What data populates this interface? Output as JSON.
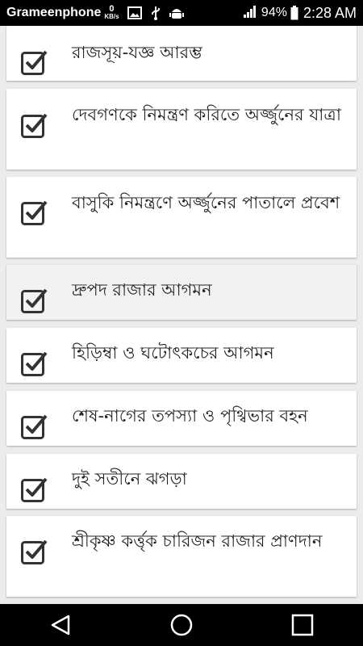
{
  "status_bar": {
    "carrier": "Grameenphone",
    "speed_value": "0",
    "speed_unit": "KB/s",
    "icons": [
      "image-icon",
      "usb-icon",
      "android-debug-icon"
    ],
    "signal": "signal-icon",
    "battery_percent": "94%",
    "time": "2:28 AM"
  },
  "chapters": [
    {
      "label": "রাজসূয়-যজ্ঞ আরম্ভ",
      "checked": true
    },
    {
      "label": "দেবগণকে নিমন্ত্রণ করিতে অর্জ্জুনের যাত্রা",
      "checked": true
    },
    {
      "label": "বাসুকি নিমন্ত্রণে অর্জ্জুনের পাতালে প্রবেশ",
      "checked": true
    },
    {
      "label": "দ্রুপদ রাজার আগমন",
      "checked": true
    },
    {
      "label": "হিড়িম্বা ও ঘটোৎকচের আগমন",
      "checked": true
    },
    {
      "label": "শেষ-নাগের তপস্যা ও পৃথ্বিভার বহন",
      "checked": true
    },
    {
      "label": "দুই সতীনে ঝগড়া",
      "checked": true
    },
    {
      "label": "শ্রীকৃষ্ণ কর্ত্তৃক চারিজন রাজার প্রাণদান",
      "checked": true
    }
  ],
  "nav": {
    "back": "back-icon",
    "home": "home-icon",
    "recents": "recents-icon"
  },
  "colors": {
    "status_bar_bg": "#000000",
    "card_bg": "#ffffff",
    "card_highlight_bg": "#f2f2f2",
    "checkbox": "#333333",
    "text": "#222222"
  }
}
